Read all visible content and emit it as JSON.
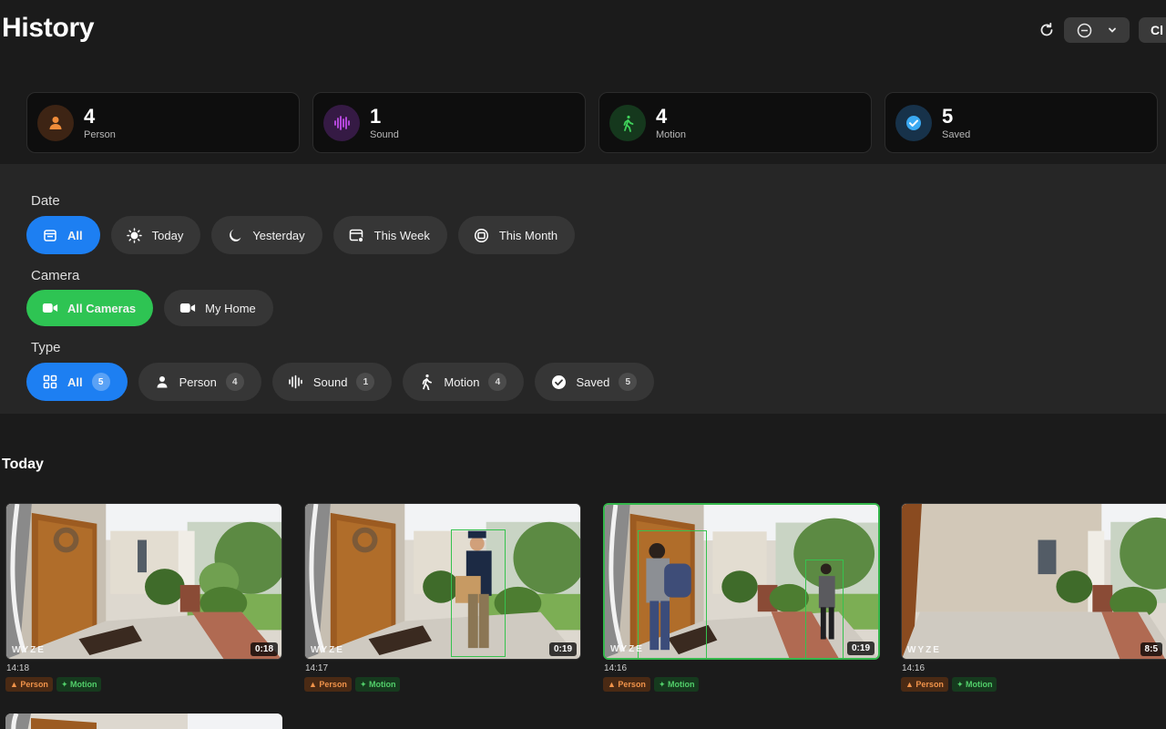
{
  "header": {
    "title": "History",
    "close_label": "Cl"
  },
  "stats": [
    {
      "count": "4",
      "label": "Person",
      "icon": "person-icon",
      "color": "#f08c3a",
      "bg": "#3d2414"
    },
    {
      "count": "1",
      "label": "Sound",
      "icon": "sound-wave-icon",
      "color": "#c04bea",
      "bg": "#351a44"
    },
    {
      "count": "4",
      "label": "Motion",
      "icon": "walking-icon",
      "color": "#3fd25a",
      "bg": "#15381d"
    },
    {
      "count": "5",
      "label": "Saved",
      "icon": "checkmark-icon",
      "color": "#3aa9f2",
      "bg": "#17324a"
    }
  ],
  "filters": {
    "date": {
      "label": "Date",
      "options": [
        {
          "label": "All",
          "icon": "calendar-icon",
          "selected": true
        },
        {
          "label": "Today",
          "icon": "sun-icon"
        },
        {
          "label": "Yesterday",
          "icon": "moon-icon"
        },
        {
          "label": "This Week",
          "icon": "calendar-week-icon"
        },
        {
          "label": "This Month",
          "icon": "calendar-month-icon"
        }
      ]
    },
    "camera": {
      "label": "Camera",
      "options": [
        {
          "label": "All Cameras",
          "icon": "video-camera-icon",
          "selected": true
        },
        {
          "label": "My Home",
          "icon": "video-camera-icon"
        }
      ]
    },
    "type": {
      "label": "Type",
      "options": [
        {
          "label": "All",
          "count": "5",
          "icon": "grid-icon",
          "selected": true
        },
        {
          "label": "Person",
          "count": "4",
          "icon": "person-icon"
        },
        {
          "label": "Sound",
          "count": "1",
          "icon": "sound-wave-icon"
        },
        {
          "label": "Motion",
          "count": "4",
          "icon": "walking-icon"
        },
        {
          "label": "Saved",
          "count": "5",
          "icon": "checkmark-circle-icon"
        }
      ]
    }
  },
  "events": {
    "section_title": "Today",
    "watermark": "WYZE",
    "items": [
      {
        "time": "14:18",
        "duration": "0:18",
        "tags": [
          "Person",
          "Motion"
        ]
      },
      {
        "time": "14:17",
        "duration": "0:19",
        "tags": [
          "Person",
          "Motion"
        ]
      },
      {
        "time": "14:16",
        "duration": "0:19",
        "tags": [
          "Person",
          "Motion"
        ],
        "selected": true
      },
      {
        "time": "14:16",
        "duration": "8:5",
        "tags": [
          "Person",
          "Motion"
        ]
      }
    ]
  }
}
